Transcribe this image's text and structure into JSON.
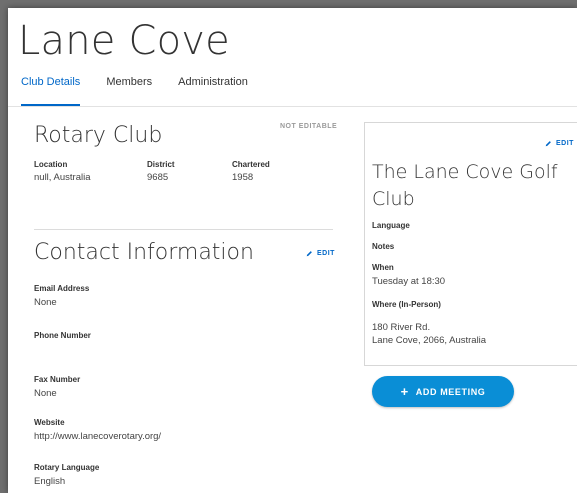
{
  "page": {
    "title": "Lane Cove"
  },
  "tabs": [
    {
      "label": "Club Details",
      "active": true
    },
    {
      "label": "Members",
      "active": false
    },
    {
      "label": "Administration",
      "active": false
    }
  ],
  "club": {
    "heading": "Rotary Club",
    "status": "NOT EDITABLE",
    "location_label": "Location",
    "location_value": "null, Australia",
    "district_label": "District",
    "district_value": "9685",
    "chartered_label": "Chartered",
    "chartered_value": "1958"
  },
  "contact": {
    "heading": "Contact Information",
    "edit_label": "EDIT",
    "email_label": "Email Address",
    "email_value": "None",
    "phone_label": "Phone Number",
    "phone_value": "",
    "fax_label": "Fax Number",
    "fax_value": "None",
    "website_label": "Website",
    "website_value": "http://www.lanecoverotary.org/",
    "language_label": "Rotary Language",
    "language_value": "English"
  },
  "meeting": {
    "edit_label": "EDIT",
    "name": "The Lane Cove Golf Club",
    "language_label": "Language",
    "notes_label": "Notes",
    "when_label": "When",
    "when_value": "Tuesday at 18:30",
    "where_label": "Where (In-Person)",
    "address_line1": "180 River Rd.",
    "address_line2": "Lane Cove, 2066, Australia"
  },
  "add_meeting": {
    "label": "ADD MEETING",
    "icon": "plus-icon"
  },
  "colors": {
    "accent": "#0067c8",
    "button": "#0a8ed6",
    "backdrop": "#6f6f6f"
  }
}
